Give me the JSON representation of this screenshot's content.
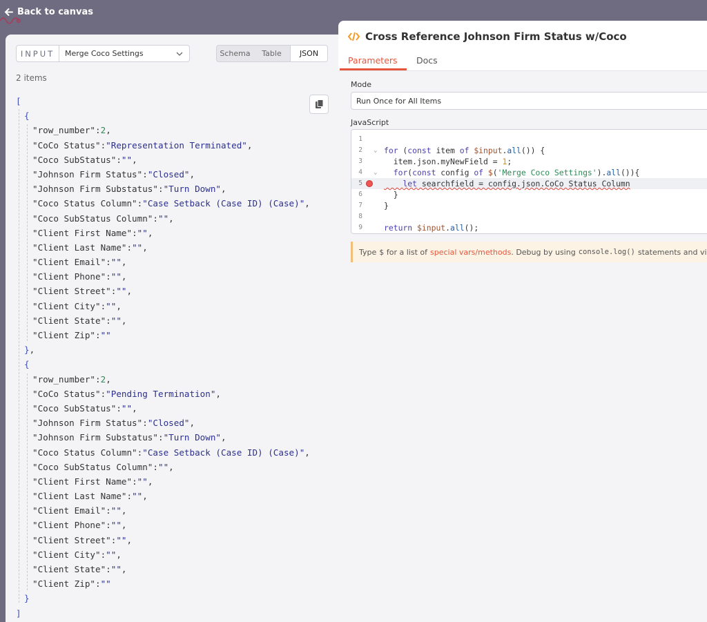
{
  "topbar": {
    "back_label": "Back to canvas"
  },
  "input_panel": {
    "label": "INPUT",
    "selected_node": "Merge Coco Settings",
    "view_modes": [
      "Schema",
      "Table",
      "JSON"
    ],
    "active_view": "JSON",
    "items_count": "2 items",
    "items": [
      {
        "row_number": "2",
        "CoCo Status": "\"Representation Terminated\"",
        "Coco SubStatus": "\"\"",
        "Johnson Firm Status": "\"Closed\"",
        "Johnson Firm Substatus": "\"Turn Down\"",
        "Coco Status Column": "\"Case Setback (Case ID) (Case)\"",
        "Coco SubStatus Column": "\"\"",
        "Client First Name": "\"\"",
        "Client Last Name": "\"\"",
        "Client Email": "\"\"",
        "Client Phone": "\"\"",
        "Client Street": "\"\"",
        "Client City": "\"\"",
        "Client State": "\"\"",
        "Client Zip": "\"\""
      },
      {
        "row_number": "2",
        "CoCo Status": "\"Pending Termination\"",
        "Coco SubStatus": "\"\"",
        "Johnson Firm Status": "\"Closed\"",
        "Johnson Firm Substatus": "\"Turn Down\"",
        "Coco Status Column": "\"Case Setback (Case ID) (Case)\"",
        "Coco SubStatus Column": "\"\"",
        "Client First Name": "\"\"",
        "Client Last Name": "\"\"",
        "Client Email": "\"\"",
        "Client Phone": "\"\"",
        "Client Street": "\"\"",
        "Client City": "\"\"",
        "Client State": "\"\"",
        "Client Zip": "\"\""
      }
    ]
  },
  "node_panel": {
    "title": "Cross Reference Johnson Firm Status w/Coco",
    "tabs": [
      "Parameters",
      "Docs"
    ],
    "active_tab": "Parameters",
    "mode_label": "Mode",
    "mode_value": "Run Once for All Items",
    "js_label": "JavaScript",
    "code_lines": [
      "",
      "for (const item of $input.all()) {",
      "  item.json.myNewField = 1;",
      "  for(const config of $('Merge Coco Settings').all()){",
      "    let searchfield = config.json.CoCo Status Column",
      "  }",
      "}",
      "",
      "return $input.all();"
    ],
    "hint": {
      "p1": "Type",
      "dollar": "$",
      "p2": "for a list of",
      "link": "special vars/methods",
      "p3": ". Debug by using",
      "code": "console.log()",
      "p4": "statements and viewing th"
    }
  },
  "colors": {
    "accent": "#e5553c",
    "panel_bg": "#f4f4f7",
    "canvas_bg": "#6f6b80"
  }
}
